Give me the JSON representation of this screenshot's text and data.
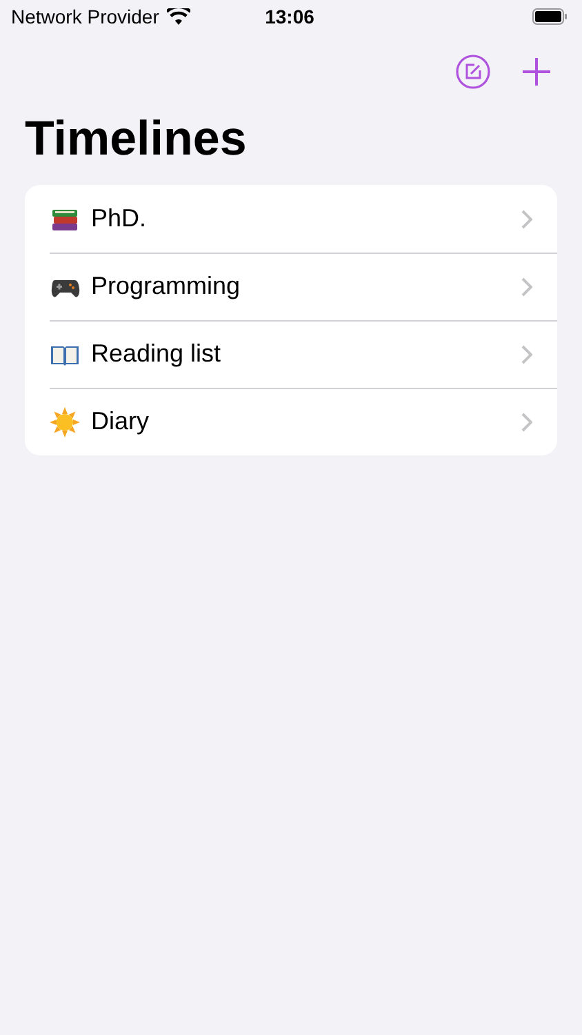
{
  "status_bar": {
    "carrier": "Network Provider",
    "time": "13:06"
  },
  "title": "Timelines",
  "timelines": [
    {
      "kind": "books",
      "label": "PhD."
    },
    {
      "kind": "gamepad",
      "label": "Programming"
    },
    {
      "kind": "book",
      "label": "Reading list"
    },
    {
      "kind": "sun",
      "label": "Diary"
    }
  ]
}
